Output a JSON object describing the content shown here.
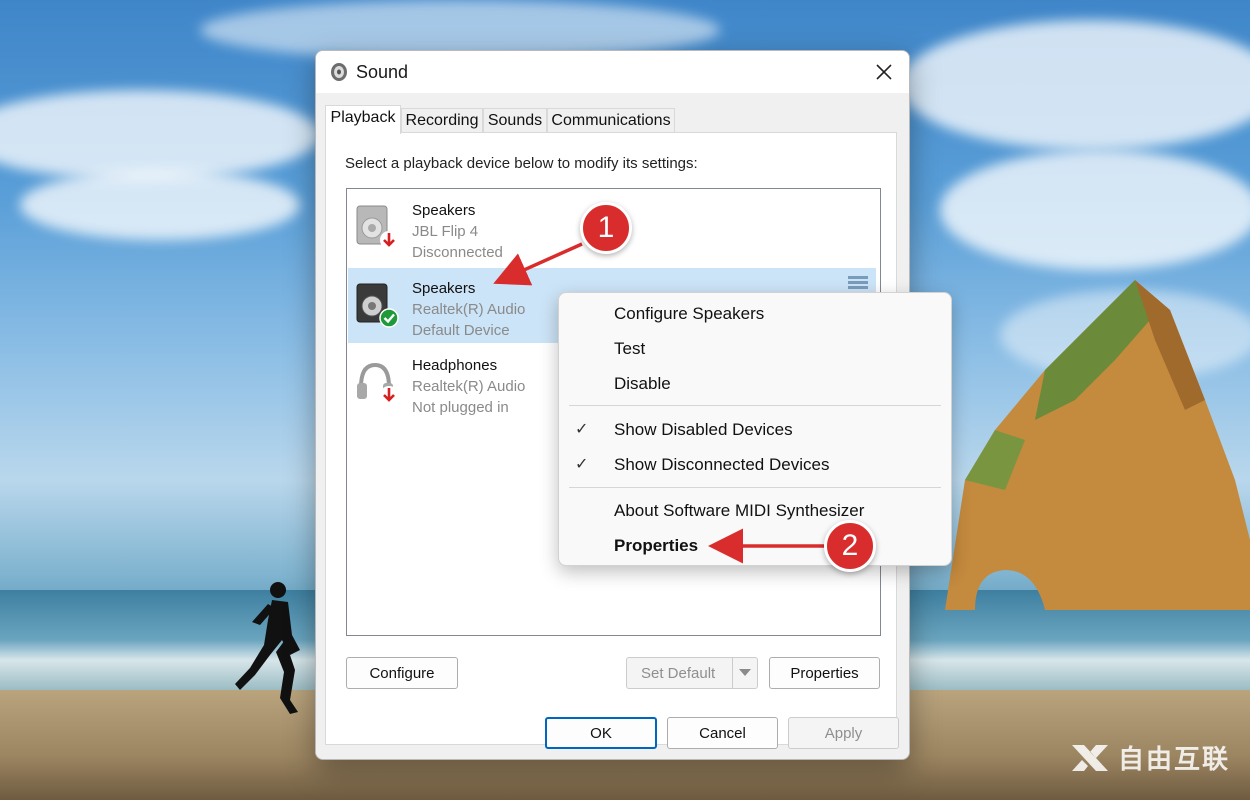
{
  "window": {
    "title": "Sound",
    "close_label": "✕"
  },
  "tabs": [
    {
      "label": "Playback"
    },
    {
      "label": "Recording"
    },
    {
      "label": "Sounds"
    },
    {
      "label": "Communications"
    }
  ],
  "instruction": "Select a playback device below to modify its settings:",
  "devices": [
    {
      "name": "Speakers",
      "line2": "JBL Flip 4",
      "line3": "Disconnected",
      "status": "disconnected"
    },
    {
      "name": "Speakers",
      "line2": "Realtek(R) Audio",
      "line3": "Default Device",
      "status": "default"
    },
    {
      "name": "Headphones",
      "line2": "Realtek(R) Audio",
      "line3": "Not plugged in",
      "status": "unplugged"
    }
  ],
  "panel_buttons": {
    "configure": "Configure",
    "set_default": "Set Default",
    "properties": "Properties"
  },
  "footer_buttons": {
    "ok": "OK",
    "cancel": "Cancel",
    "apply": "Apply"
  },
  "context_menu": {
    "items": [
      {
        "label": "Configure Speakers"
      },
      {
        "label": "Test"
      },
      {
        "label": "Disable"
      },
      {
        "label": "Show Disabled Devices",
        "checked": true
      },
      {
        "label": "Show Disconnected Devices",
        "checked": true
      },
      {
        "label": "About Software MIDI Synthesizer"
      },
      {
        "label": "Properties",
        "bold": true
      }
    ],
    "check_glyph": "✓"
  },
  "annotations": [
    {
      "number": "1"
    },
    {
      "number": "2"
    }
  ],
  "watermark": "自由互联",
  "colors": {
    "selection": "#cce4f7",
    "badge_red": "#d92d2d",
    "accent": "#0067c0"
  }
}
